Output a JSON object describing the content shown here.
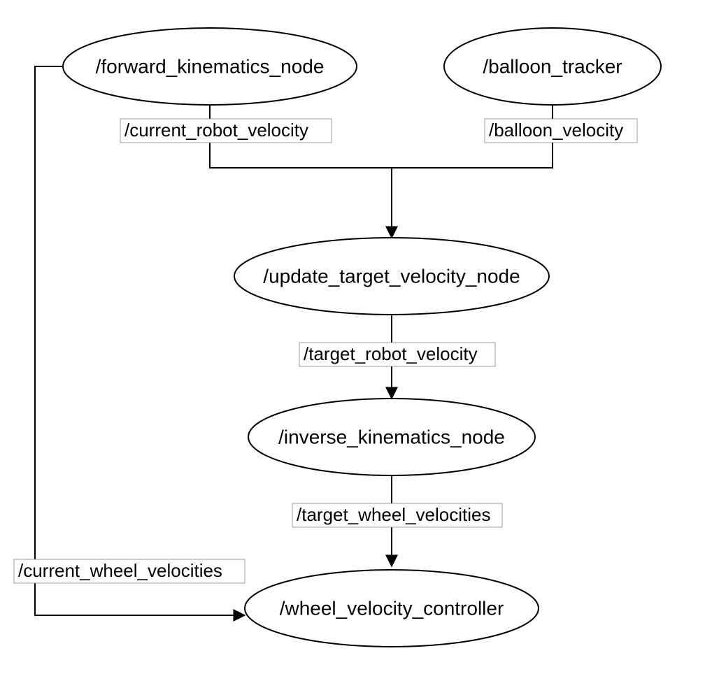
{
  "diagram": {
    "type": "ros-computation-graph",
    "nodes": {
      "forward_kinematics": {
        "label": "/forward_kinematics_node"
      },
      "balloon_tracker": {
        "label": "/balloon_tracker"
      },
      "update_target_velocity": {
        "label": "/update_target_velocity_node"
      },
      "inverse_kinematics": {
        "label": "/inverse_kinematics_node"
      },
      "wheel_velocity_controller": {
        "label": "/wheel_velocity_controller"
      }
    },
    "edges": {
      "current_robot_velocity": {
        "label": "/current_robot_velocity",
        "from": "forward_kinematics",
        "to": "update_target_velocity"
      },
      "balloon_velocity": {
        "label": "/balloon_velocity",
        "from": "balloon_tracker",
        "to": "update_target_velocity"
      },
      "target_robot_velocity": {
        "label": "/target_robot_velocity",
        "from": "update_target_velocity",
        "to": "inverse_kinematics"
      },
      "target_wheel_velocities": {
        "label": "/target_wheel_velocities",
        "from": "inverse_kinematics",
        "to": "wheel_velocity_controller"
      },
      "current_wheel_velocities": {
        "label": "/current_wheel_velocities",
        "from": "forward_kinematics",
        "to": "wheel_velocity_controller"
      }
    }
  }
}
